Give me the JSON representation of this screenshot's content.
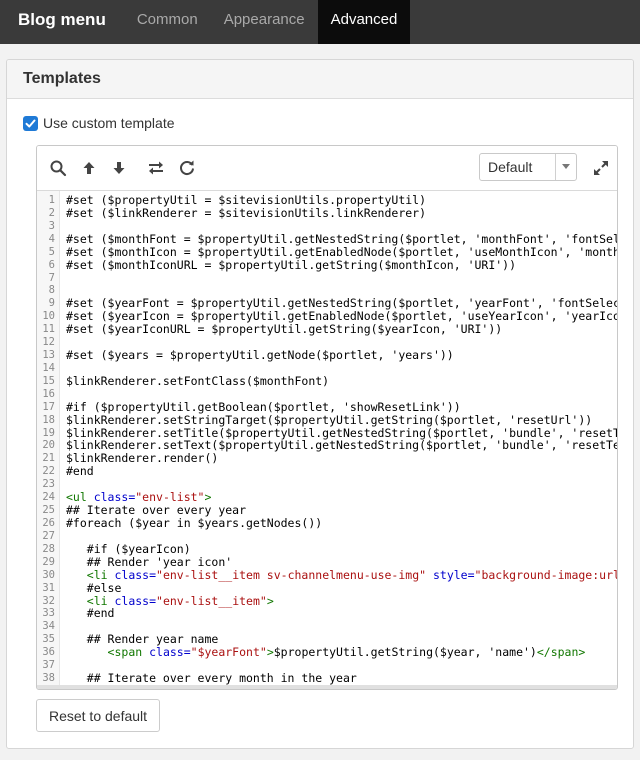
{
  "header": {
    "title": "Blog menu",
    "tabs": [
      {
        "label": "Common",
        "active": false
      },
      {
        "label": "Appearance",
        "active": false
      },
      {
        "label": "Advanced",
        "active": true
      }
    ]
  },
  "panel": {
    "title": "Templates",
    "checkbox": {
      "label": "Use custom template",
      "checked": true
    },
    "editor": {
      "toolbar": {
        "icons": [
          "search-icon",
          "arrow-up-icon",
          "arrow-down-icon",
          "swap-icon",
          "refresh-icon",
          "expand-icon"
        ],
        "theme_select": "Default"
      },
      "lines": [
        {
          "n": "1",
          "segs": [
            {
              "t": "#set ($propertyUtil = $sitevisionUtils.propertyUtil)"
            }
          ]
        },
        {
          "n": "2",
          "segs": [
            {
              "t": "#set ($linkRenderer = $sitevisionUtils.linkRenderer)"
            }
          ]
        },
        {
          "n": "3",
          "segs": []
        },
        {
          "n": "4",
          "segs": [
            {
              "t": "#set ($monthFont = $propertyUtil.getNestedString($portlet, 'monthFont', 'fontSelecto"
            }
          ]
        },
        {
          "n": "5",
          "segs": [
            {
              "t": "#set ($monthIcon = $propertyUtil.getEnabledNode($portlet, 'useMonthIcon', 'monthIcon'"
            }
          ]
        },
        {
          "n": "6",
          "segs": [
            {
              "t": "#set ($monthIconURL = $propertyUtil.getString($monthIcon, 'URI'))"
            }
          ]
        },
        {
          "n": "7",
          "segs": []
        },
        {
          "n": "8",
          "segs": []
        },
        {
          "n": "9",
          "segs": [
            {
              "t": "#set ($yearFont = $propertyUtil.getNestedString($portlet, 'yearFont', 'fontSelector'"
            }
          ]
        },
        {
          "n": "10",
          "segs": [
            {
              "t": "#set ($yearIcon = $propertyUtil.getEnabledNode($portlet, 'useYearIcon', 'yearIcon'))"
            }
          ]
        },
        {
          "n": "11",
          "segs": [
            {
              "t": "#set ($yearIconURL = $propertyUtil.getString($yearIcon, 'URI'))"
            }
          ]
        },
        {
          "n": "12",
          "segs": []
        },
        {
          "n": "13",
          "segs": [
            {
              "t": "#set ($years = $propertyUtil.getNode($portlet, 'years'))"
            }
          ]
        },
        {
          "n": "14",
          "segs": []
        },
        {
          "n": "15",
          "segs": [
            {
              "t": "$linkRenderer.setFontClass($monthFont)"
            }
          ]
        },
        {
          "n": "16",
          "segs": []
        },
        {
          "n": "17",
          "segs": [
            {
              "t": "#if ($propertyUtil.getBoolean($portlet, 'showResetLink'))"
            }
          ]
        },
        {
          "n": "18",
          "segs": [
            {
              "t": "$linkRenderer.setStringTarget($propertyUtil.getString($portlet, 'resetUrl'))"
            }
          ]
        },
        {
          "n": "19",
          "segs": [
            {
              "t": "$linkRenderer.setTitle($propertyUtil.getNestedString($portlet, 'bundle', 'resetTitle"
            }
          ]
        },
        {
          "n": "20",
          "segs": [
            {
              "t": "$linkRenderer.setText($propertyUtil.getNestedString($portlet, 'bundle', 'resetText'"
            }
          ]
        },
        {
          "n": "21",
          "segs": [
            {
              "t": "$linkRenderer.render()"
            }
          ]
        },
        {
          "n": "22",
          "segs": [
            {
              "t": "#end"
            }
          ]
        },
        {
          "n": "23",
          "segs": []
        },
        {
          "n": "24",
          "segs": [
            {
              "t": "<ul ",
              "c": "tag"
            },
            {
              "t": "class=",
              "c": "attr"
            },
            {
              "t": "\"env-list\"",
              "c": "str"
            },
            {
              "t": ">",
              "c": "tag"
            }
          ]
        },
        {
          "n": "25",
          "segs": [
            {
              "t": "## Iterate over every year"
            }
          ]
        },
        {
          "n": "26",
          "segs": [
            {
              "t": "#foreach ($year in $years.getNodes())"
            }
          ]
        },
        {
          "n": "27",
          "segs": []
        },
        {
          "n": "28",
          "segs": [
            {
              "t": "   #if ($yearIcon)"
            }
          ]
        },
        {
          "n": "29",
          "segs": [
            {
              "t": "   ## Render 'year icon'"
            }
          ]
        },
        {
          "n": "30",
          "segs": [
            {
              "t": "   "
            },
            {
              "t": "<li ",
              "c": "tag"
            },
            {
              "t": "class=",
              "c": "attr"
            },
            {
              "t": "\"env-list__item sv-channelmenu-use-img\"",
              "c": "str"
            },
            {
              "t": " style=",
              "c": "attr"
            },
            {
              "t": "\"background-image:url",
              "c": "str"
            }
          ]
        },
        {
          "n": "31",
          "segs": [
            {
              "t": "   #else"
            }
          ]
        },
        {
          "n": "32",
          "segs": [
            {
              "t": "   "
            },
            {
              "t": "<li ",
              "c": "tag"
            },
            {
              "t": "class=",
              "c": "attr"
            },
            {
              "t": "\"env-list__item\"",
              "c": "str"
            },
            {
              "t": ">",
              "c": "tag"
            }
          ]
        },
        {
          "n": "33",
          "segs": [
            {
              "t": "   #end"
            }
          ]
        },
        {
          "n": "34",
          "segs": []
        },
        {
          "n": "35",
          "segs": [
            {
              "t": "   ## Render year name"
            }
          ]
        },
        {
          "n": "36",
          "segs": [
            {
              "t": "      "
            },
            {
              "t": "<span ",
              "c": "tag"
            },
            {
              "t": "class=",
              "c": "attr"
            },
            {
              "t": "\"$yearFont\"",
              "c": "str"
            },
            {
              "t": ">",
              "c": "tag"
            },
            {
              "t": "$propertyUtil.getString($year, 'name')"
            },
            {
              "t": "</span>",
              "c": "tag"
            }
          ]
        },
        {
          "n": "37",
          "segs": []
        },
        {
          "n": "38",
          "segs": [
            {
              "t": "   ## Iterate over every month in the year"
            }
          ]
        }
      ]
    },
    "reset_label": "Reset to default"
  },
  "colors": {
    "topbar_bg": "#3a3a3a",
    "active_tab_bg": "#0c0c0c",
    "checkbox_accent": "#1f7ad6",
    "tag": "#117700",
    "attr": "#0000cc",
    "string": "#aa1111"
  }
}
